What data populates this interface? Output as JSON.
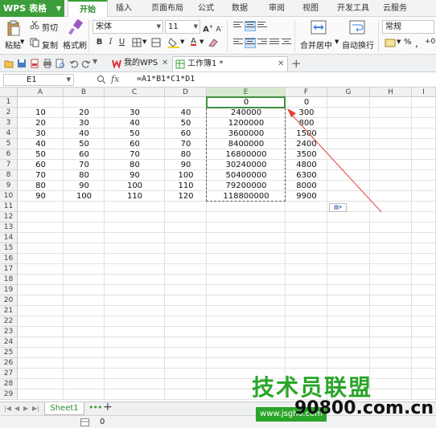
{
  "app": {
    "name": "WPS 表格"
  },
  "menu_tabs": [
    "开始",
    "插入",
    "页面布局",
    "公式",
    "数据",
    "审阅",
    "视图",
    "开发工具",
    "云服务"
  ],
  "ribbon": {
    "paste": "粘贴",
    "cut": "剪切",
    "copy": "复制",
    "format_painter": "格式刷",
    "font_name": "宋体",
    "font_size": "11",
    "merge_center": "合并居中",
    "wrap_text": "自动换行",
    "number_format": "常规",
    "percent": "%"
  },
  "doc_tabs": [
    {
      "label": "我的WPS",
      "active": false
    },
    {
      "label": "工作簿1 *",
      "active": true
    }
  ],
  "formula_bar": {
    "cell_ref": "E1",
    "fx": "fx",
    "formula": "=A1*B1*C1*D1"
  },
  "columns": [
    "A",
    "B",
    "C",
    "D",
    "E",
    "F",
    "G",
    "H",
    "I"
  ],
  "selected_column": "E",
  "rows": [
    "1",
    "2",
    "3",
    "4",
    "5",
    "6",
    "7",
    "8",
    "9",
    "10",
    "11",
    "12",
    "13",
    "14",
    "15",
    "16",
    "17",
    "18",
    "19",
    "20",
    "21",
    "22",
    "23",
    "24",
    "25",
    "26",
    "27",
    "28",
    "29"
  ],
  "cells": [
    [
      "",
      "",
      "",
      "",
      "0",
      "0"
    ],
    [
      "10",
      "20",
      "30",
      "40",
      "240000",
      "300"
    ],
    [
      "20",
      "30",
      "40",
      "50",
      "1200000",
      "800"
    ],
    [
      "30",
      "40",
      "50",
      "60",
      "3600000",
      "1500"
    ],
    [
      "40",
      "50",
      "60",
      "70",
      "8400000",
      "2400"
    ],
    [
      "50",
      "60",
      "70",
      "80",
      "16800000",
      "3500"
    ],
    [
      "60",
      "70",
      "80",
      "90",
      "30240000",
      "4800"
    ],
    [
      "70",
      "80",
      "90",
      "100",
      "50400000",
      "6300"
    ],
    [
      "80",
      "90",
      "100",
      "110",
      "79200000",
      "8000"
    ],
    [
      "90",
      "100",
      "110",
      "120",
      "118800000",
      "9900"
    ]
  ],
  "sheet_tabs": [
    "Sheet1"
  ],
  "status": {
    "value": "0"
  },
  "watermark": {
    "title": "技术员联盟",
    "url": "90800.com.cn",
    "band": "www.jsgho.com"
  },
  "colors": {
    "accent": "#3b9e3a",
    "arrow": "#e0413a"
  }
}
